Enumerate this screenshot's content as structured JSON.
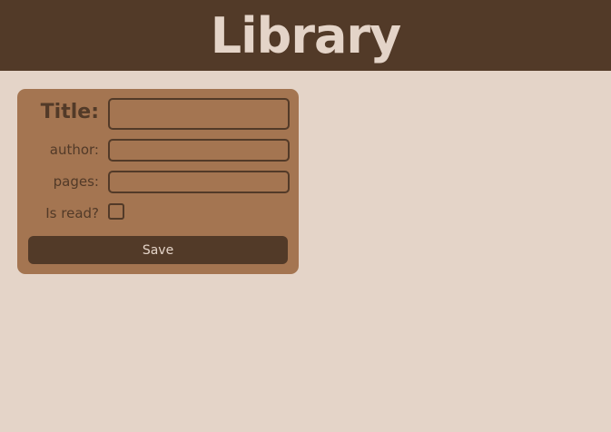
{
  "header": {
    "title": "Library"
  },
  "form": {
    "title_label": "Title:",
    "title_value": "",
    "author_label": "author:",
    "author_value": "",
    "pages_label": "pages:",
    "pages_value": "",
    "is_read_label": "Is read?",
    "is_read_checked": false,
    "save_label": "Save"
  },
  "colors": {
    "background": "#e4d4c8",
    "header": "#523a28",
    "card": "#a47551",
    "accent_text": "#523a28"
  }
}
